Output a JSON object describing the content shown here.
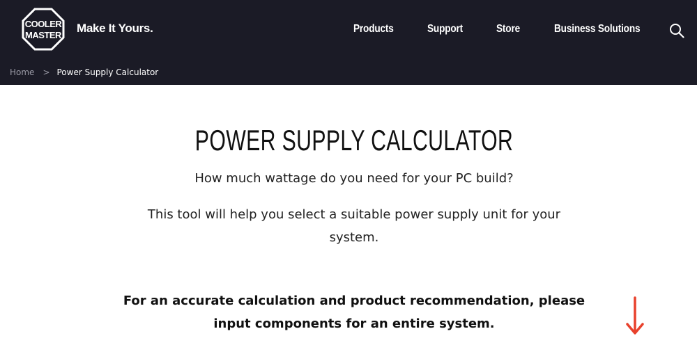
{
  "header": {
    "logo_text_line1": "COOLER",
    "logo_text_line2": "MASTER",
    "tagline": "Make It Yours.",
    "nav": [
      {
        "label": "Products"
      },
      {
        "label": "Support"
      },
      {
        "label": "Store"
      },
      {
        "label": "Business Solutions"
      }
    ],
    "search_icon": "search-icon",
    "background_color": "#1b1b26"
  },
  "breadcrumb": {
    "home": "Home",
    "separator": ">",
    "current": "Power Supply Calculator"
  },
  "main": {
    "title": "POWER SUPPLY CALCULATOR",
    "subtitle": "How much wattage do you need for your PC build?",
    "description": "This tool will help you select a suitable power supply unit for your system.",
    "notice": "For an accurate calculation and product recommendation, please input components for an entire system.",
    "arrow_icon": "arrow-down-icon",
    "arrow_color": "#e8412c"
  }
}
